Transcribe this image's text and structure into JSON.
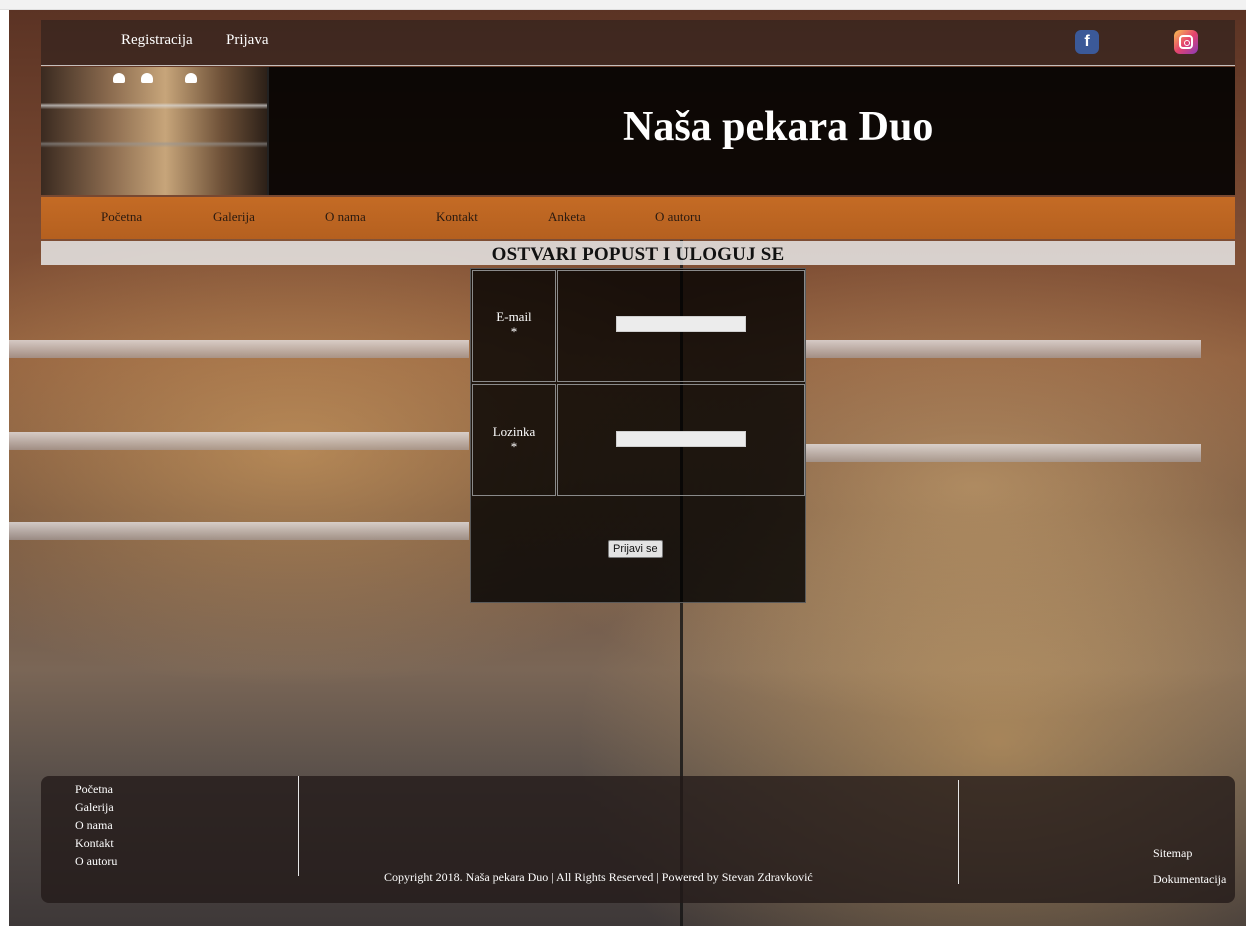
{
  "top_bar": {
    "links": [
      "Registracija",
      "Prijava"
    ],
    "social": [
      {
        "name": "facebook-icon",
        "glyph": "f",
        "color": "#3b5998"
      },
      {
        "name": "instagram-icon",
        "color": "#e5446d"
      }
    ]
  },
  "header": {
    "title": "Naša pekara Duo"
  },
  "nav": {
    "items": [
      "Početna",
      "Galerija",
      "O nama",
      "Kontakt",
      "Anketa",
      "O autoru"
    ],
    "color": "#b96220"
  },
  "login": {
    "heading": "OSTVARI POPUST I ULOGUJ SE",
    "email_label": "E-mail",
    "password_label": "Lozinka",
    "required_mark": "*",
    "email_value": "",
    "password_value": "",
    "submit_label": "Prijavi se"
  },
  "footer": {
    "links": [
      "Početna",
      "Galerija",
      "O nama",
      "Kontakt",
      "O autoru"
    ],
    "copyright": "Copyright 2018. Naša pekara Duo | All Rights Reserved | Powered by Stevan Zdravković",
    "right_links": [
      "Sitemap",
      "Dokumentacija"
    ]
  }
}
